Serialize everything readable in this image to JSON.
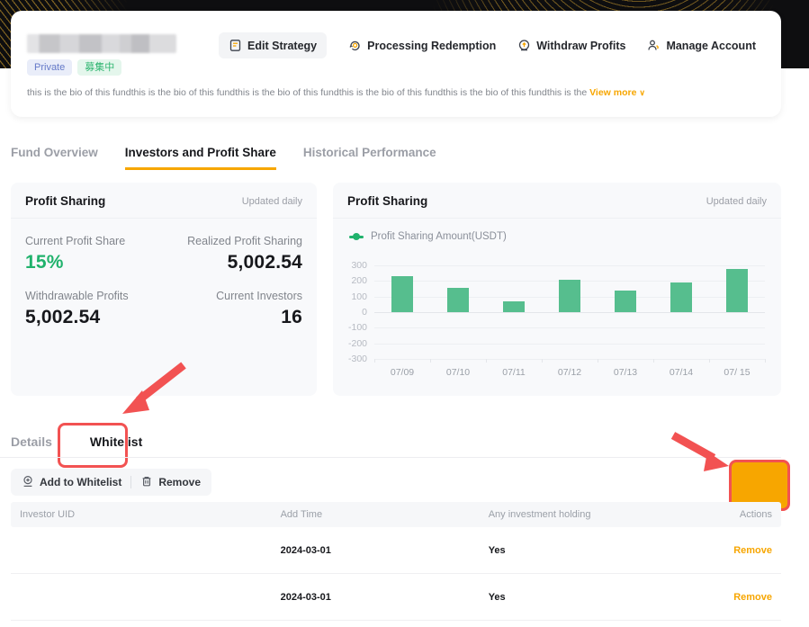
{
  "colors": {
    "accent_orange": "#f7a600",
    "annotation_red": "#f25252",
    "positive_green": "#20b26c",
    "bar_green": "#56be8e",
    "banner_black": "#0e0e10",
    "banner_gold": "#bd922c"
  },
  "header": {
    "badges": [
      {
        "label": "Private"
      },
      {
        "label": "募集中"
      }
    ],
    "bio": "this is the bio of this fundthis is the bio of this fundthis is the bio of this fundthis is the bio of this fundthis is the bio of this fundthis is the",
    "view_more_label": "View more",
    "view_more_caret": "∨",
    "actions": [
      {
        "label": "Edit Strategy",
        "icon": "edit-strategy-icon"
      },
      {
        "label": "Processing Redemption",
        "icon": "processing-redemption-icon"
      },
      {
        "label": "Withdraw Profits",
        "icon": "withdraw-profits-icon"
      },
      {
        "label": "Manage Account",
        "icon": "manage-account-icon"
      }
    ]
  },
  "main_tabs": [
    {
      "label": "Fund Overview",
      "active": false
    },
    {
      "label": "Investors and Profit Share",
      "active": true
    },
    {
      "label": "Historical Performance",
      "active": false
    }
  ],
  "stats_card": {
    "title": "Profit Sharing",
    "updated": "Updated daily",
    "stats": [
      {
        "label": "Current Profit Share",
        "value": "15%"
      },
      {
        "label": "Realized Profit Sharing",
        "value": "5,002.54"
      },
      {
        "label": "Withdrawable Profits",
        "value": "5,002.54"
      },
      {
        "label": "Current Investors",
        "value": "16"
      }
    ]
  },
  "chart_card": {
    "title": "Profit Sharing",
    "updated": "Updated daily"
  },
  "chart_data": {
    "type": "bar",
    "title": "Profit Sharing",
    "legend": "Profit Sharing Amount(USDT)",
    "categories": [
      "07/09",
      "07/10",
      "07/11",
      "07/12",
      "07/13",
      "07/14",
      "07/ 15"
    ],
    "values": [
      230,
      155,
      70,
      205,
      140,
      190,
      275
    ],
    "xlabel": "",
    "ylabel": "",
    "ylim": [
      -300,
      300
    ],
    "yticks": [
      300,
      200,
      100,
      0,
      -100,
      -200,
      -300
    ],
    "grid": true,
    "legend_position": "top-left",
    "bar_color": "#56be8e"
  },
  "sub_tabs": [
    {
      "label": "Details",
      "active": false
    },
    {
      "label": "Whitelist",
      "active": true
    }
  ],
  "toolbar": {
    "add_label": "Add to Whitelist",
    "add_icon": "add-to-whitelist-icon",
    "remove_label": "Remove",
    "remove_icon": "trash-icon"
  },
  "whitelist_toggle": {
    "state": "on"
  },
  "table": {
    "headers": [
      "Investor UID",
      "Add Time",
      "Any investment holding",
      "Actions"
    ],
    "rows": [
      {
        "add_time": "2024-03-01",
        "holding": "Yes",
        "action": "Remove"
      },
      {
        "add_time": "2024-03-01",
        "holding": "Yes",
        "action": "Remove"
      }
    ]
  }
}
